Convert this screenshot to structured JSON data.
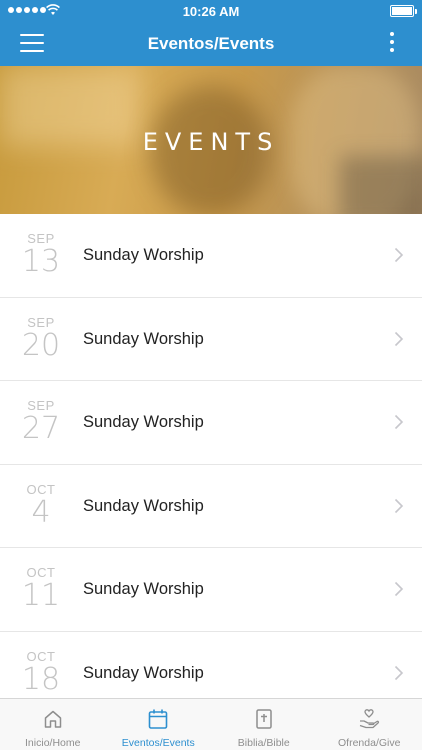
{
  "status_bar": {
    "time": "10:26 AM"
  },
  "nav": {
    "title": "Eventos/Events"
  },
  "hero": {
    "title": "EVENTS"
  },
  "events": [
    {
      "month": "SEP",
      "day": "13",
      "name": "Sunday Worship"
    },
    {
      "month": "SEP",
      "day": "20",
      "name": "Sunday Worship"
    },
    {
      "month": "SEP",
      "day": "27",
      "name": "Sunday Worship"
    },
    {
      "month": "OCT",
      "day": "4",
      "name": "Sunday Worship"
    },
    {
      "month": "OCT",
      "day": "11",
      "name": "Sunday Worship"
    },
    {
      "month": "OCT",
      "day": "18",
      "name": "Sunday Worship"
    }
  ],
  "tabs": [
    {
      "label": "Inicio/Home",
      "icon": "home-icon",
      "active": false
    },
    {
      "label": "Eventos/Events",
      "icon": "calendar-icon",
      "active": true
    },
    {
      "label": "Biblia/Bible",
      "icon": "bible-icon",
      "active": false
    },
    {
      "label": "Ofrenda/Give",
      "icon": "give-icon",
      "active": false
    }
  ],
  "colors": {
    "brand": "#2d8fcf",
    "inactive_tab": "#8e8e8e",
    "date_text": "#c4c4c4"
  }
}
